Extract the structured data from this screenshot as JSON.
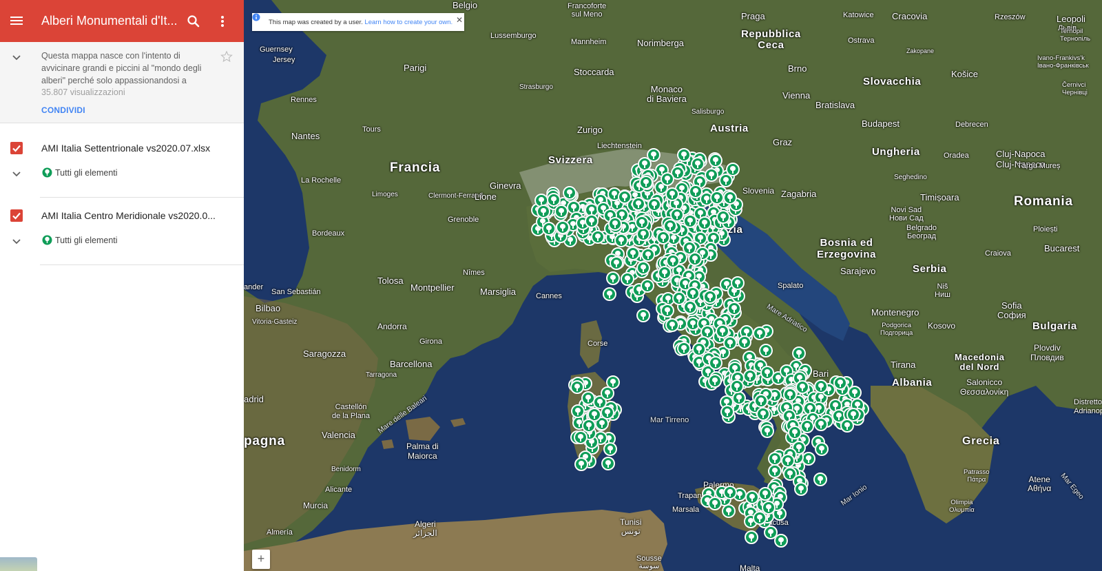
{
  "panel": {
    "title": "Alberi Monumentali d'It...",
    "description": "Questa mappa nasce con l'intento di avvicinare grandi e piccini al \"mondo degli alberi\" perché solo appassionandosi a",
    "views": "35.807 visualizzazioni",
    "share_label": "CONDIVIDI",
    "layers": [
      {
        "name": "AMI Italia Settentrionale vs2020.07.xlsx",
        "items_label": "Tutti gli elementi"
      },
      {
        "name": "AMI Italia Centro Meridionale vs2020.0...",
        "items_label": "Tutti gli elementi"
      }
    ]
  },
  "map": {
    "banner_text": "This map was created by a user.",
    "banner_link": "Learn how to create your own.",
    "zoom_in_label": "+",
    "labels": {
      "belgio": "Belgio",
      "francoforte": "Francoforte\nsul Meno",
      "praga": "Praga",
      "katowice": "Katowice",
      "cracovia": "Cracovia",
      "rzeszow": "Rzeszów",
      "leopoli": "Leopoli",
      "leopoli_cyr": "Львів",
      "guernsey": "Guernsey",
      "jersey": "Jersey",
      "lussemburgo": "Lussemburgo",
      "mannheim": "Mannheim",
      "norimberga": "Norimberga",
      "repubblica_ceca": "Repubblica\nCeca",
      "ostrava": "Ostrava",
      "zakopane": "Zakopane",
      "ternopil": "Ternopil\nТернопіль",
      "ivano": "Ivano-Frankivs'k\nІвано-Франківськ",
      "parigi": "Parigi",
      "stoccarda": "Stoccarda",
      "brno": "Brno",
      "slovacchia": "Slovacchia",
      "kosice": "Košice",
      "cernivci": "Černivci\nЧернівці",
      "strasburgo": "Strasburgo",
      "monaco": "Monaco\ndi Baviera",
      "vienna": "Vienna",
      "bratislava": "Bratislava",
      "rennes": "Rennes",
      "salisburgo": "Salisburgo",
      "zurigo": "Zurigo",
      "austria": "Austria",
      "budapest": "Budapest",
      "debrecen": "Debrecen",
      "nantes": "Nantes",
      "tours": "Tours",
      "liechtenstein": "Liechtenstein",
      "graz": "Graz",
      "svizzera": "Svizzera",
      "ungheria": "Ungheria",
      "oradea": "Oradea",
      "cluj": "Cluj-Napoca\nCluj-Napoca",
      "francia": "Francia",
      "ginevra": "Ginevra",
      "targu": "Târgu Mureș",
      "seghedino": "Seghedino",
      "la_rochelle": "La Rochelle",
      "limoges": "Limoges",
      "clermont": "Clermont-Ferrand",
      "lione": "Lione",
      "slovenia": "Slovenia",
      "zagabria": "Zagabria",
      "timisoara": "Timișoara",
      "romania": "Romania",
      "novi_sad": "Novi Sad\nНови Сад",
      "grenoble": "Grenoble",
      "croazia": "Croazia",
      "belgrado": "Belgrado\nБеоград",
      "ploiesti": "Ploiești",
      "bordeaux": "Bordeaux",
      "bosnia": "Bosnia ed\nErzegovina",
      "bucarest": "Bucarest",
      "craiova": "Craiova",
      "nimes": "Nîmes",
      "sarajevo": "Sarajevo",
      "serbia": "Serbia",
      "tolosa": "Tolosa",
      "montpellier": "Montpellier",
      "marsiglia": "Marsiglia",
      "san_sebastian": "San Sebastián",
      "nander": "ander",
      "cannes": "Cannes",
      "spalato": "Spalato",
      "nis": "Niš\nНиш",
      "bilbao": "Bilbao",
      "sofia": "Sofia\nСофия",
      "vitoria": "Vitoria-Gasteiz",
      "mare_adriatico": "Mare Adriatico",
      "montenegro": "Montenegro",
      "podgorica": "Podgorica\nПодгорица",
      "kosovo": "Kosovo",
      "andorra": "Andorra",
      "bulgaria": "Bulgaria",
      "girona": "Girona",
      "corse": "Corse",
      "plovdiv": "Plovdiv\nПловдив",
      "saragozza": "Saragozza",
      "barcellona": "Barcellona",
      "tirana": "Tirana",
      "macedonia": "Macedonia\ndel Nord",
      "tarragona": "Tarragona",
      "bari": "Bari",
      "albania": "Albania",
      "salonicco": "Salonicco\nΘεσσαλονίκη",
      "madrid": "adrid",
      "castellon": "Castellón\nde la Plana",
      "mare_baleari": "Mare delle Baleari",
      "mar_tirreno": "Mar Tirreno",
      "distretto": "Distretto\nAdrianopoli",
      "valencia": "Valencia",
      "palma": "Palma di\nMaiorca",
      "spagna": "pagna",
      "grecia": "Grecia",
      "benidorm": "Benidorm",
      "alicante": "Alicante",
      "patrasso": "Patrasso\nΠάτρα",
      "atene": "Atene\nΑθήνα",
      "palermo": "Palermo",
      "trapani": "Trapani",
      "marsala": "Marsala",
      "siracusa": "Siracusa",
      "mar_ionio": "Mar Ionio",
      "mar_egeo": "Mar Egeo",
      "olimpia": "Olimpia\nΟλυμπία",
      "murcia": "Murcia",
      "almeria": "Almería",
      "algeri": "Algeri\nالجزائر",
      "tunisi": "Tunisi\nتونس",
      "sousse": "Sousse\nسوسة",
      "malta": "Malta"
    }
  }
}
